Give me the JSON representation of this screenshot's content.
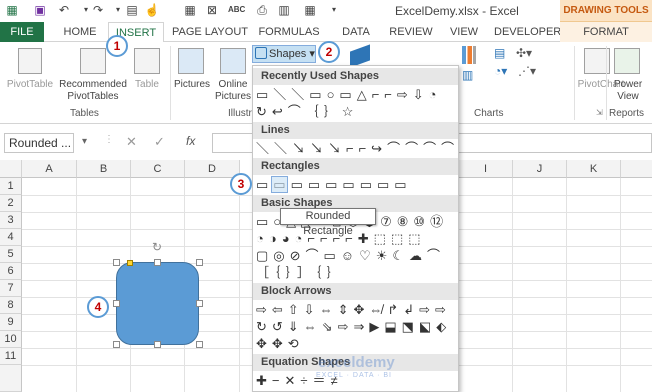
{
  "titlebar": {
    "title": "ExcelDemy.xlsx - Excel",
    "context_tab": "DRAWING TOOLS"
  },
  "tabs": [
    "FILE",
    "HOME",
    "INSERT",
    "PAGE LAYOUT",
    "FORMULAS",
    "DATA",
    "REVIEW",
    "VIEW",
    "DEVELOPER",
    "FORMAT"
  ],
  "ribbon": {
    "pivot_table": "PivotTable",
    "recommended_pivot": "Recommended PivotTables",
    "table": "Table",
    "group_tables": "Tables",
    "pictures": "Pictures",
    "online_pictures": "Online Pictures",
    "group_illustrations": "Illustr",
    "shapes": "Shapes",
    "pivot_chart": "PivotChart",
    "power_view": "Power View",
    "group_charts": "Charts",
    "group_reports": "Reports"
  },
  "namebox": "Rounded ...",
  "fx": "fx",
  "columns": [
    "A",
    "B",
    "C",
    "D",
    "I",
    "J",
    "K"
  ],
  "rows": [
    "1",
    "2",
    "3",
    "4",
    "5",
    "6",
    "7",
    "8",
    "9",
    "10",
    "11"
  ],
  "dropdown": {
    "sec_recent": "Recently Used Shapes",
    "recent_1": "▭＼＼▭○▭△⌐⌐⇨⇩◔",
    "recent_2": "↻↩⌒｛｝☆",
    "sec_lines": "Lines",
    "lines_1": "＼＼↘↘↘⌐⌐↪⌒⌒⌒⌒",
    "sec_rect": "Rectangles",
    "rect_1": "▭▭▭▭▭▭▭▭▭",
    "sec_basic": "Basic Shapes",
    "basic_1": "▭○△◺▱⬠⬡⬢⑦⑧⑩⑫",
    "basic_2": "◔◑◕◔⌐⌐⌐⌐✚⬚⬚⬚",
    "basic_3": "▢◎⊘⌒▭☺♡☀☾☁⌒",
    "basic_4": "［｛｝］｛｝",
    "sec_arrows": "Block Arrows",
    "arrows_1": "⇨⇦⇧⇩⇔⇕✥⇎↱↲⇨⇨",
    "arrows_2": "↻↺⇓⇔⇘⇨⇒▶⬓⬔⬕⬖",
    "arrows_3": "✥✥⟲",
    "sec_equation": "Equation Shapes",
    "equation_1": "✚−✕÷＝≠"
  },
  "tooltip": "Rounded Rectangle",
  "watermark": "exceldemy",
  "watermark_sub": "EXCEL · DATA · BI",
  "badges": [
    "1",
    "2",
    "3",
    "4"
  ],
  "colors": {
    "excel_green": "#217346",
    "shape_fill": "#5b9bd5",
    "badge_ring": "#5b9bd5",
    "badge_text": "#c00000"
  }
}
